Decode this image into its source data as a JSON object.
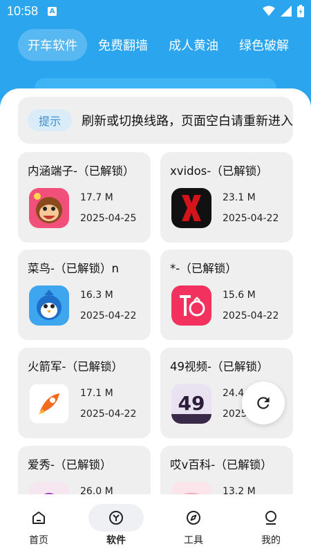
{
  "status_bar": {
    "time": "10:58",
    "notification_icon_letter": "A"
  },
  "tabs": [
    {
      "label": "开车软件",
      "active": true
    },
    {
      "label": "免费翻墙",
      "active": false
    },
    {
      "label": "成人黄油",
      "active": false
    },
    {
      "label": "绿色破解",
      "active": false
    }
  ],
  "notice": {
    "tag": "提示",
    "text": "刷新或切换线路，页面空白请重新进入"
  },
  "apps": [
    {
      "name": "内涵端子-（已解锁）",
      "size": "17.7 M",
      "date": "2025-04-25",
      "icon": "monkey-icon"
    },
    {
      "name": "xvidos-（已解锁）",
      "size": "23.1 M",
      "date": "2025-04-22",
      "icon": "x-logo-icon"
    },
    {
      "name": "菜鸟-（已解锁）n",
      "size": "16.3 M",
      "date": "2025-04-22",
      "icon": "penguin-icon"
    },
    {
      "name": "*-（已解锁）",
      "size": "15.6 M",
      "date": "2025-04-22",
      "icon": "tomato-icon"
    },
    {
      "name": "火箭军-（已解锁）",
      "size": "17.1 M",
      "date": "2025-04-22",
      "icon": "rocket-icon"
    },
    {
      "name": "49视频-（已解锁）",
      "size": "24.4 M",
      "date": "2025-04-22",
      "icon": "49-logo-icon"
    },
    {
      "name": "爱秀-（已解锁）",
      "size": "26.0 M",
      "date": "",
      "icon": "flower-icon"
    },
    {
      "name": "哎v百科-（已解锁）",
      "size": "13.2 M",
      "date": "",
      "icon": "pink-logo-icon"
    }
  ],
  "fab": {
    "icon": "refresh-icon"
  },
  "bottom_nav": [
    {
      "label": "首页",
      "icon": "home-icon",
      "active": false
    },
    {
      "label": "软件",
      "icon": "cube-icon",
      "active": true
    },
    {
      "label": "工具",
      "icon": "compass-icon",
      "active": false
    },
    {
      "label": "我的",
      "icon": "profile-icon",
      "active": false
    }
  ],
  "colors": {
    "primary": "#2aa5ee",
    "card_bg": "#efefef",
    "tag_text": "#3a8fd0"
  }
}
